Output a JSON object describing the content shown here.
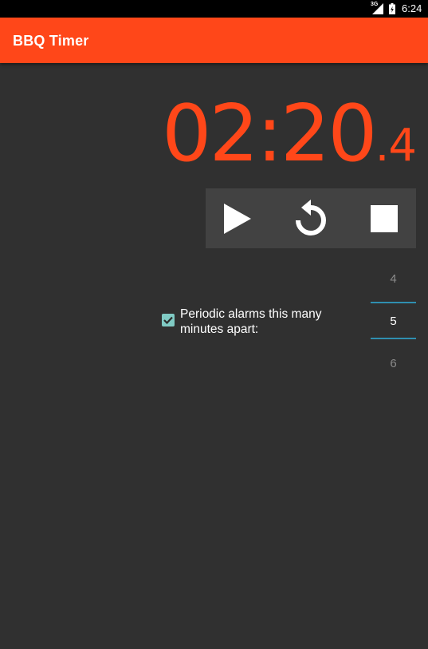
{
  "status_bar": {
    "network_label": "3G",
    "time": "6:24"
  },
  "app_bar": {
    "title": "BBQ Timer"
  },
  "timer": {
    "main": "02:20",
    "tenths": ".4"
  },
  "controls": {
    "play_icon": "play-icon",
    "reset_icon": "replay-icon",
    "stop_icon": "stop-icon"
  },
  "periodic_alarm": {
    "checked": true,
    "label": "Periodic alarms this many minutes apart:"
  },
  "minutes_picker": {
    "previous": "4",
    "selected": "5",
    "next": "6"
  },
  "colors": {
    "accent": "#ff4719",
    "background": "#303030",
    "controls_background": "#424242",
    "checkbox": "#80cbc4",
    "picker_divider": "#2f8fb0"
  }
}
